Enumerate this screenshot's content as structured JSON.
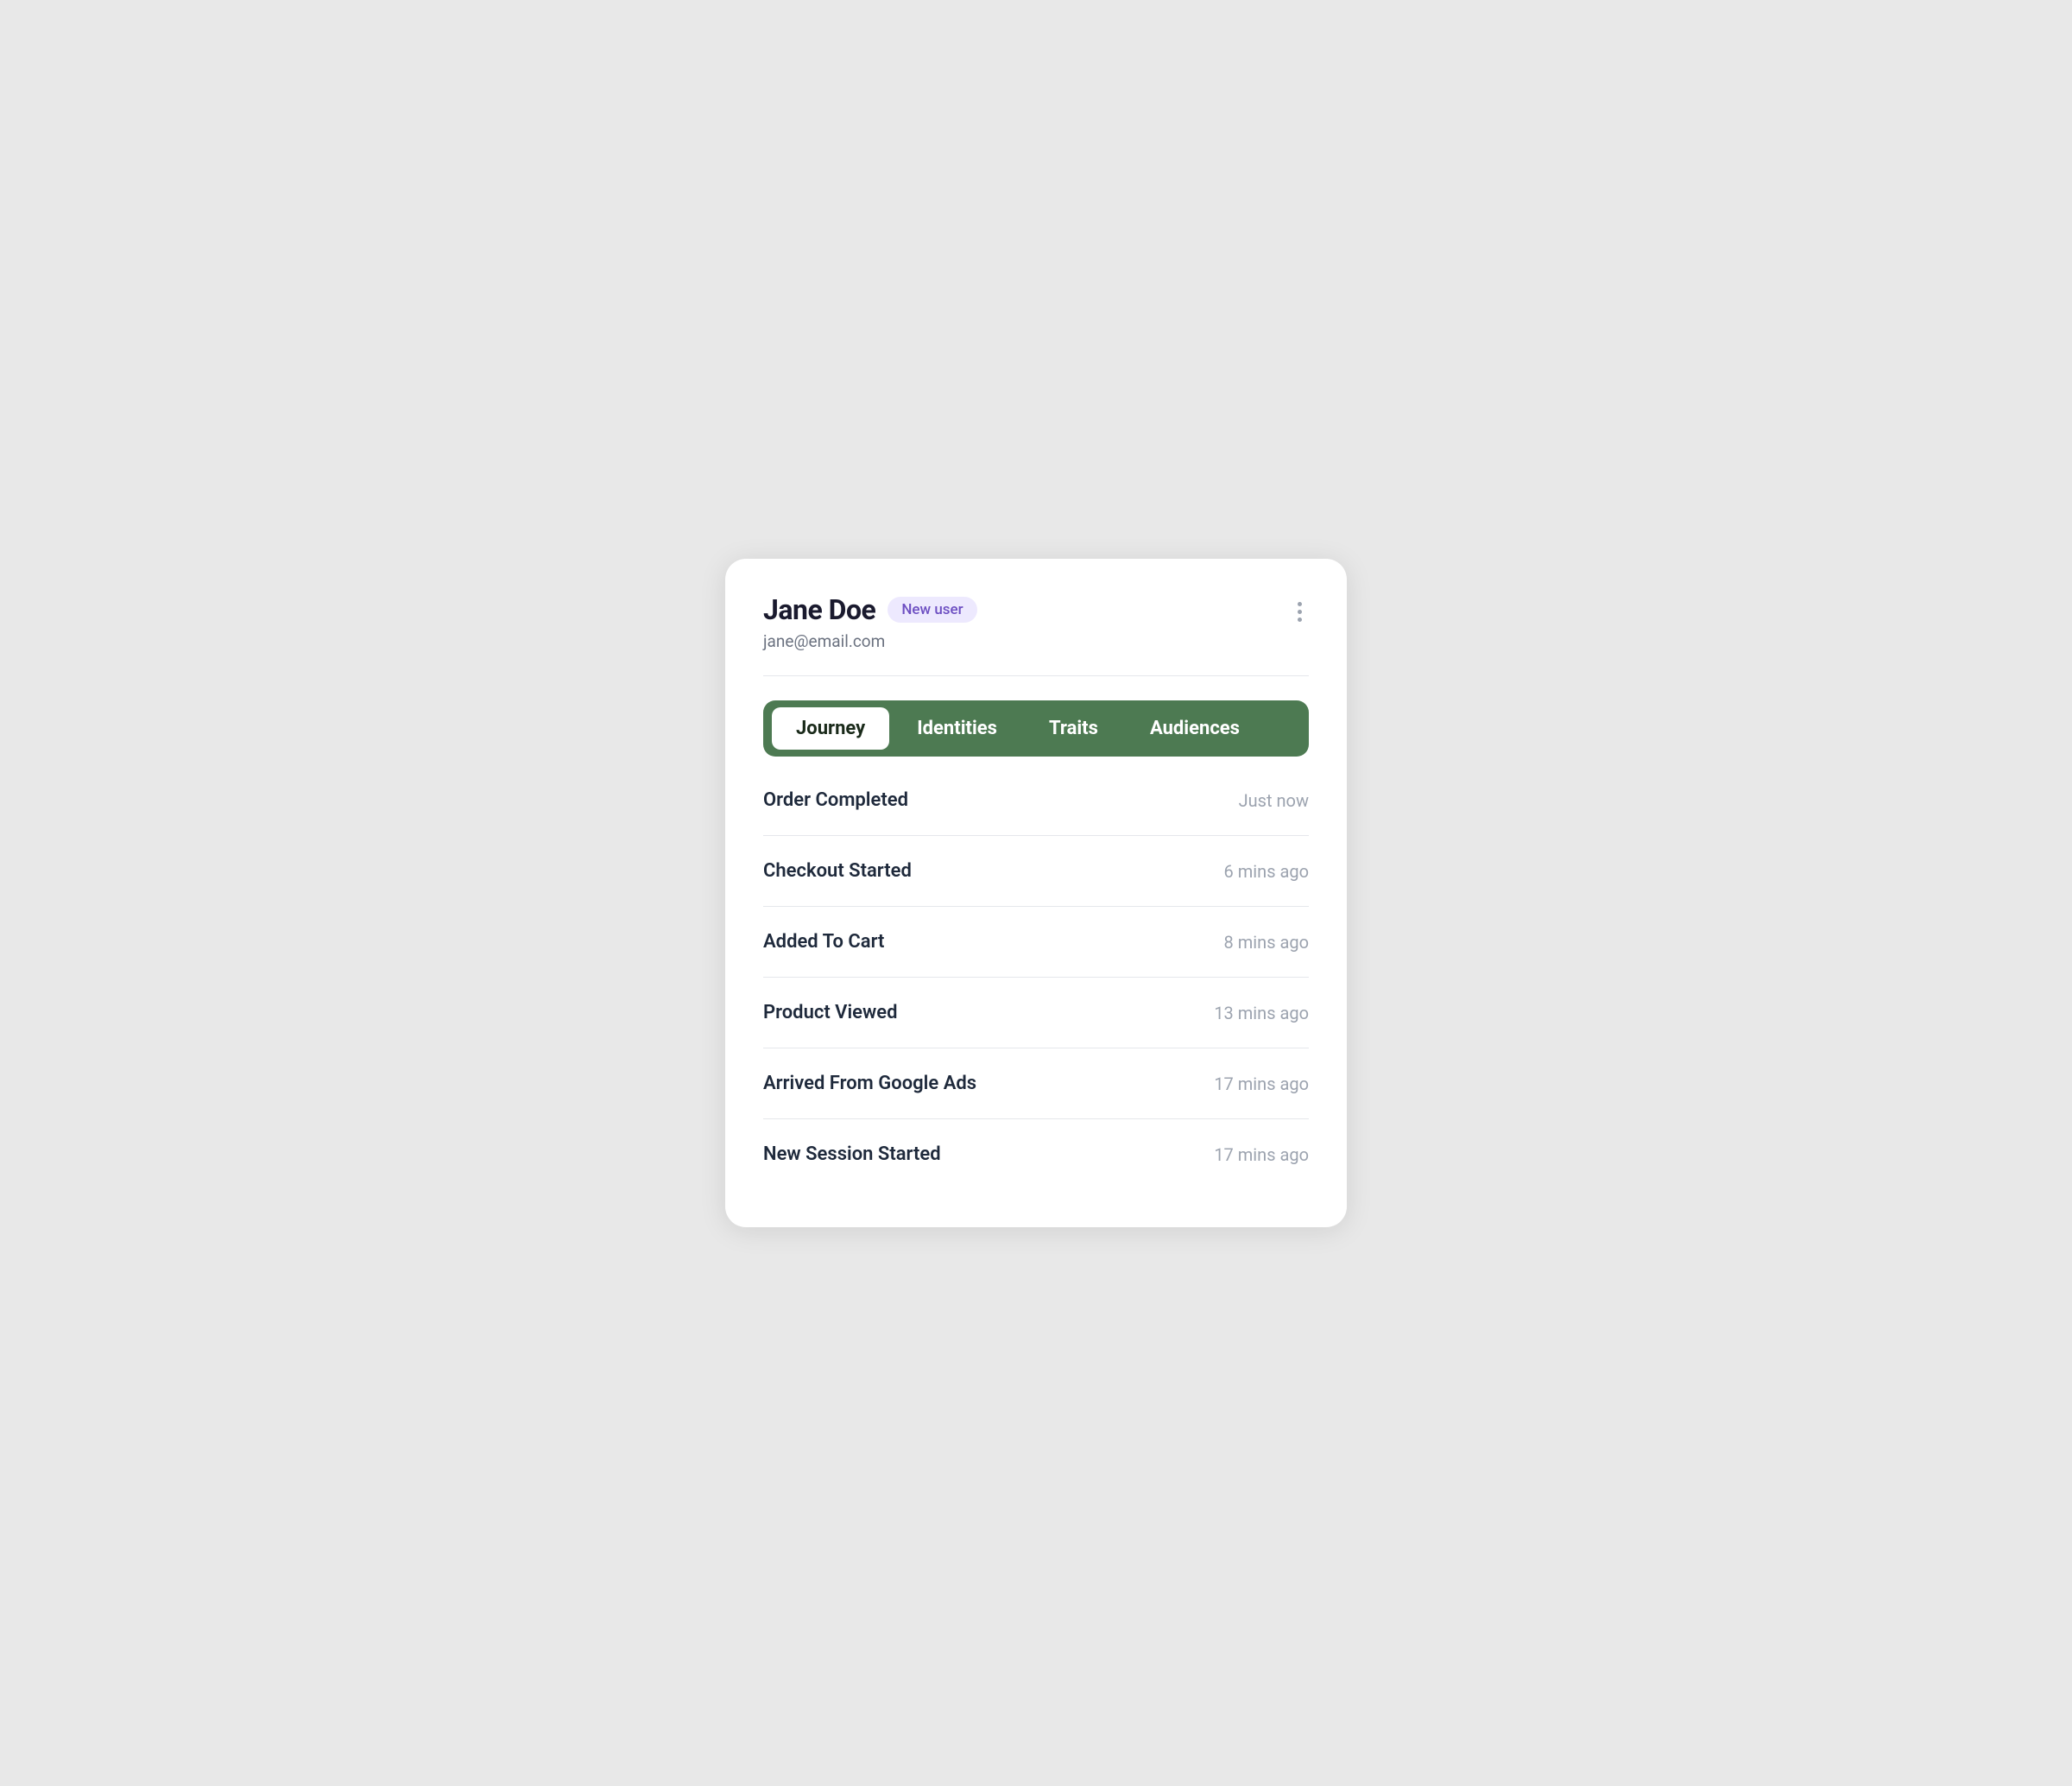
{
  "header": {
    "user_name": "Jane Doe",
    "badge_label": "New user",
    "user_email": "jane@email.com",
    "more_icon_label": "more-options"
  },
  "tabs": {
    "items": [
      {
        "label": "Journey",
        "active": true
      },
      {
        "label": "Identities",
        "active": false
      },
      {
        "label": "Traits",
        "active": false
      },
      {
        "label": "Audiences",
        "active": false
      }
    ]
  },
  "journey": {
    "events": [
      {
        "name": "Order Completed",
        "time": "Just now"
      },
      {
        "name": "Checkout Started",
        "time": "6 mins ago"
      },
      {
        "name": "Added To Cart",
        "time": "8 mins ago"
      },
      {
        "name": "Product Viewed",
        "time": "13 mins ago"
      },
      {
        "name": "Arrived From Google Ads",
        "time": "17 mins ago"
      },
      {
        "name": "New Session Started",
        "time": "17 mins ago"
      }
    ]
  }
}
